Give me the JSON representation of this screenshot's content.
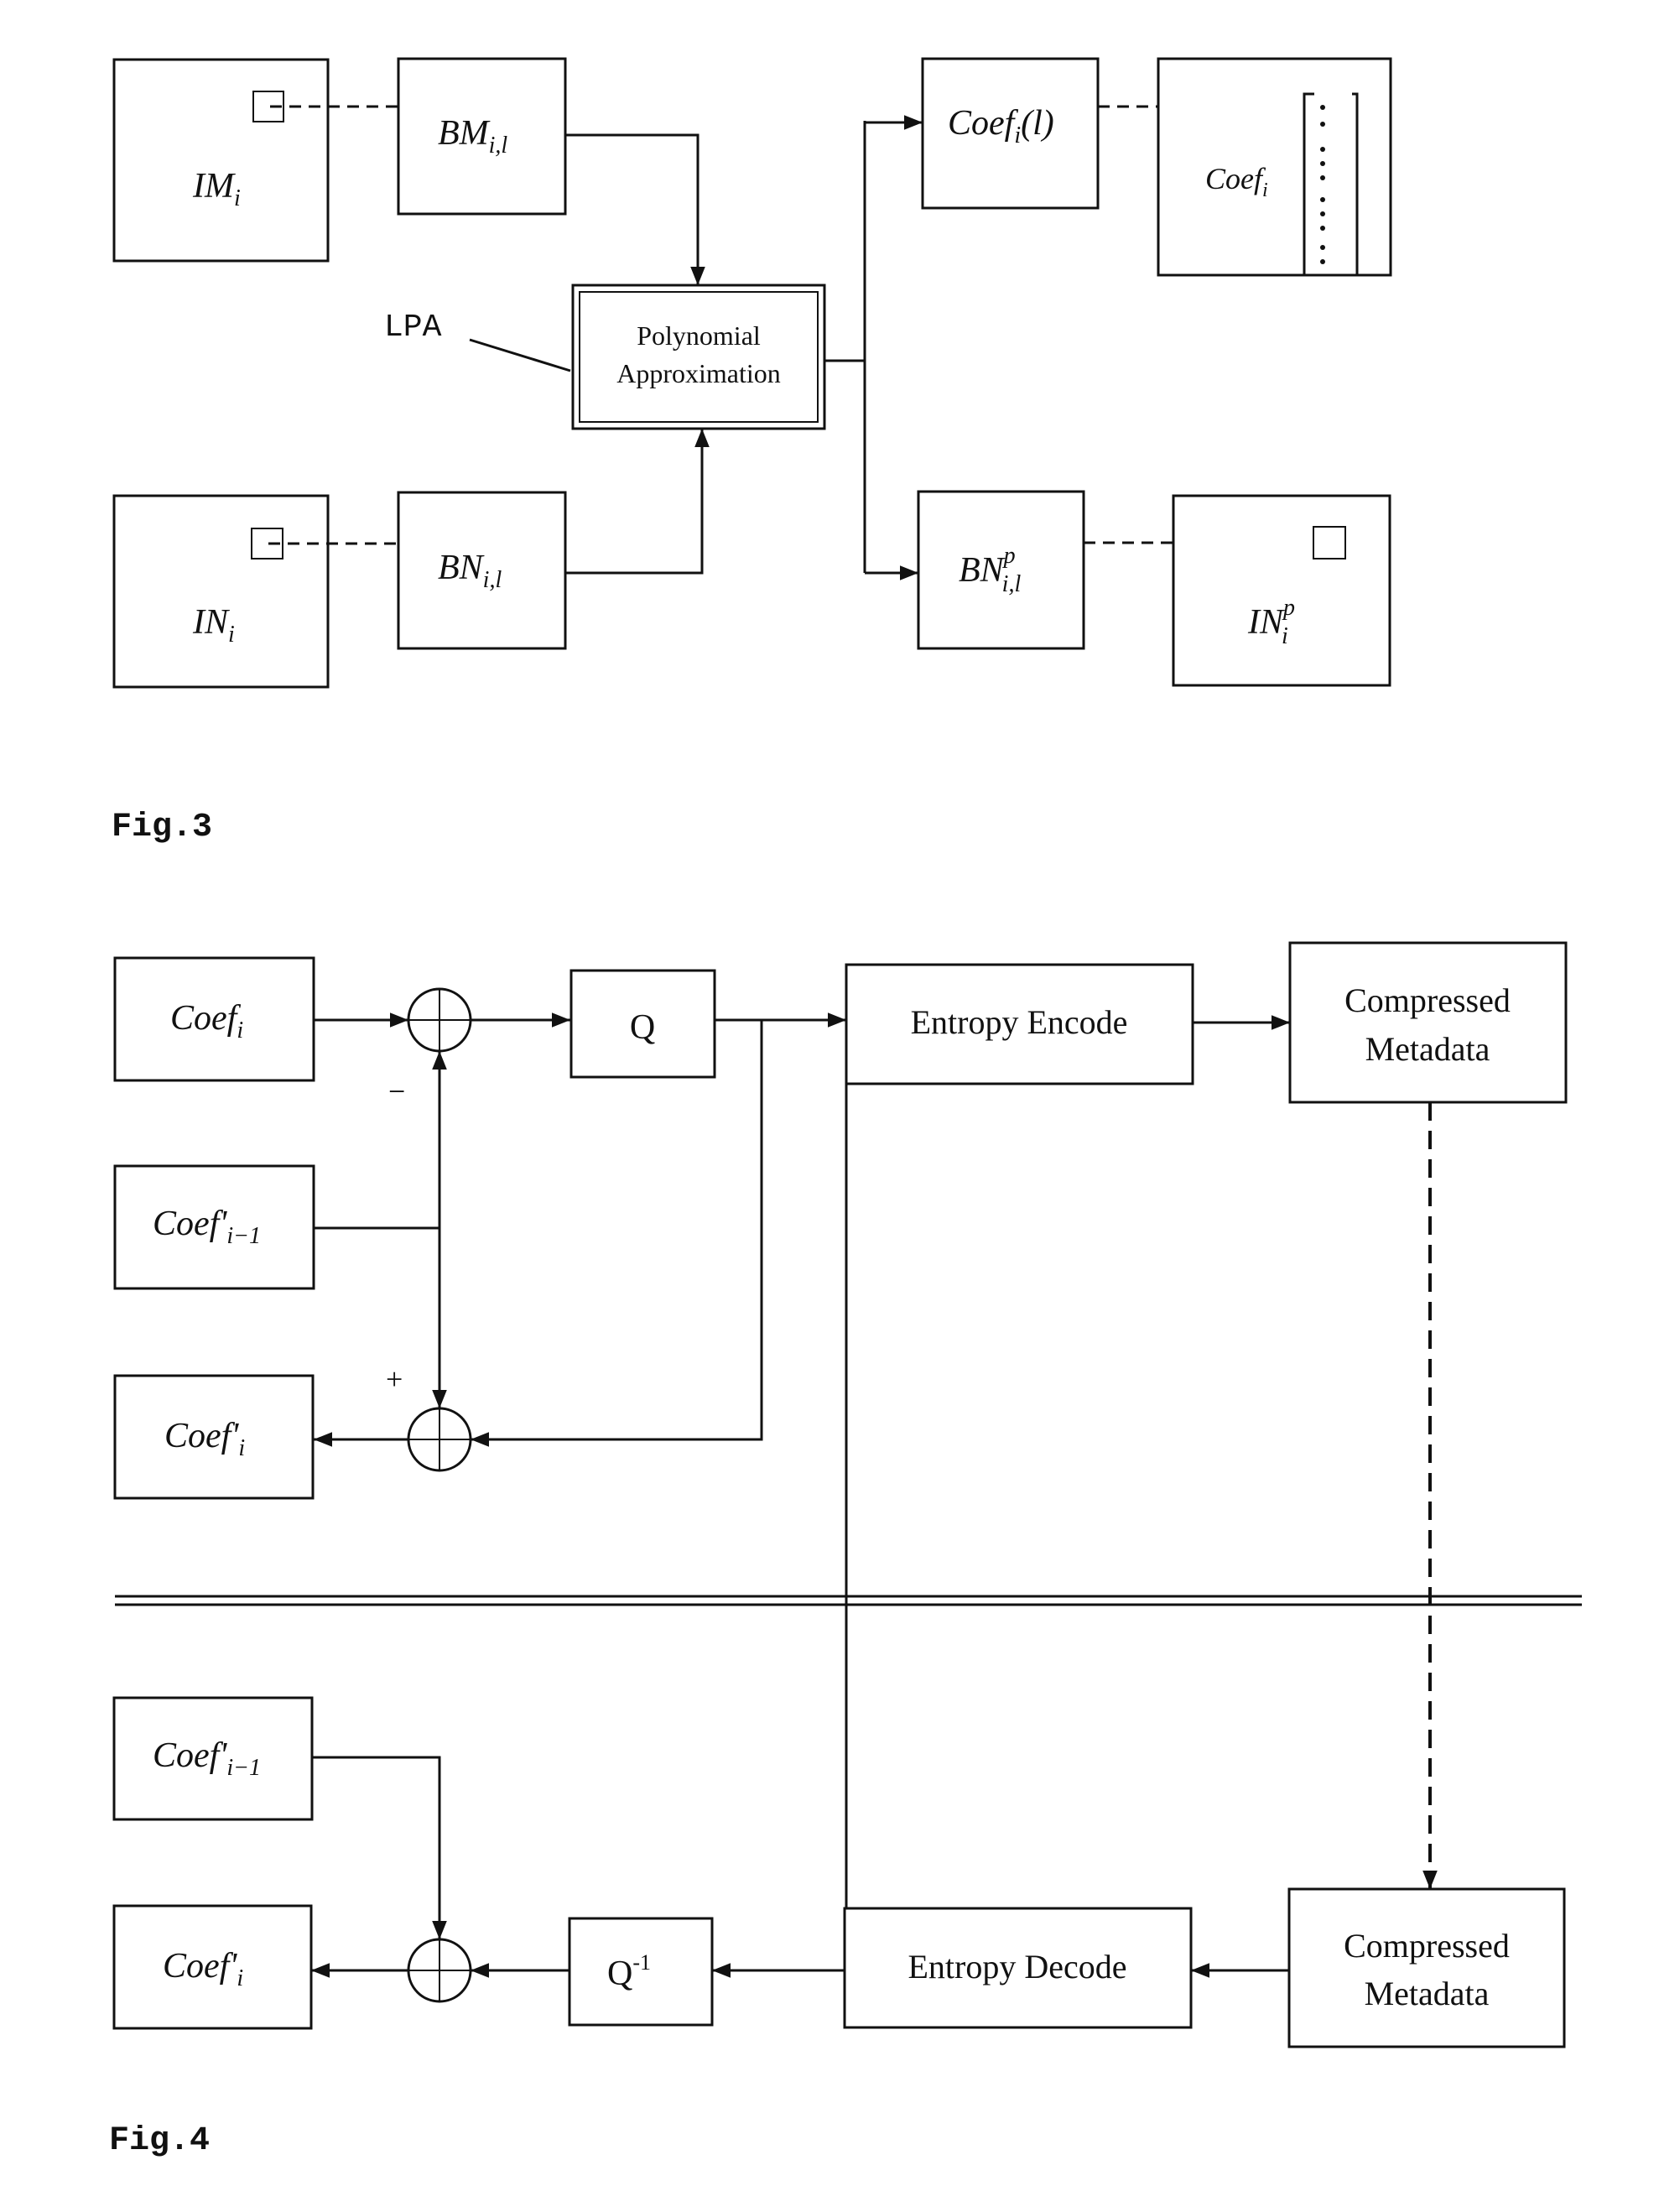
{
  "fig3": {
    "caption": "Fig.3",
    "im_label": "IM",
    "im_sub": "i",
    "bm_label": "BM",
    "bm_sub": "i,l",
    "in_label": "IN",
    "in_sub": "i",
    "bn_label": "BN",
    "bn_sub": "i,l",
    "lpa_label": "LPA",
    "poly_line1": "Polynomial",
    "poly_line2": "Approximation",
    "coefl_label": "Coef",
    "coefl_sub": "i",
    "coefl_arg": "(l)",
    "coef_label": "Coef",
    "coef_sub": "i",
    "bnp_label": "BN",
    "bnp_sup": "p",
    "bnp_sub": "i,l",
    "inp_label": "IN",
    "inp_sup": "p",
    "inp_sub": "i"
  },
  "fig4": {
    "caption": "Fig.4",
    "coef_i": {
      "base": "Coef",
      "sub": "i"
    },
    "coef_prev_enc": {
      "base": "Coef'",
      "sub": "i−1"
    },
    "coef_rec_enc": {
      "base": "Coef'",
      "sub": "i"
    },
    "minus_sign": "−",
    "plus_sign": "+",
    "q_label": "Q",
    "entropy_encode": "Entropy Encode",
    "compressed_enc_line1": "Compressed",
    "compressed_enc_line2": "Metadata",
    "coef_prev_dec": {
      "base": "Coef'",
      "sub": "i−1"
    },
    "coef_rec_dec": {
      "base": "Coef'",
      "sub": "i"
    },
    "qinv_label": "Q",
    "qinv_sup": "-1",
    "entropy_decode": "Entropy Decode",
    "compressed_dec_line1": "Compressed",
    "compressed_dec_line2": "Metadata"
  }
}
